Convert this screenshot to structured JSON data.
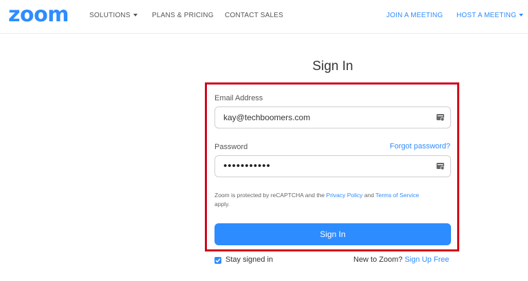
{
  "header": {
    "logo": "zoom",
    "nav_left": [
      {
        "label": "SOLUTIONS",
        "dropdown": true
      },
      {
        "label": "PLANS & PRICING",
        "dropdown": false
      },
      {
        "label": "CONTACT SALES",
        "dropdown": false
      }
    ],
    "nav_right": [
      {
        "label": "JOIN A MEETING",
        "dropdown": false
      },
      {
        "label": "HOST A MEETING",
        "dropdown": true
      }
    ]
  },
  "form": {
    "title": "Sign In",
    "email_label": "Email Address",
    "email_value": "kay@techboomers.com",
    "password_label": "Password",
    "forgot_password": "Forgot password?",
    "password_value": "•••••••••••",
    "recaptcha_prefix": "Zoom is protected by reCAPTCHA and the",
    "privacy_policy": "Privacy Policy",
    "and_text": "and",
    "terms_of_service": "Terms of Service",
    "recaptcha_suffix": "apply.",
    "signin_button": "Sign In",
    "stay_signed_in": "Stay signed in",
    "stay_signed_in_checked": true,
    "new_to_zoom": "New to Zoom?",
    "sign_up_free": "Sign Up Free"
  },
  "colors": {
    "brand": "#2d8cff",
    "highlight": "#d0021b"
  },
  "icons": {
    "field_icon": "password-manager-key-icon",
    "checkbox_icon": "checkmark-icon"
  }
}
